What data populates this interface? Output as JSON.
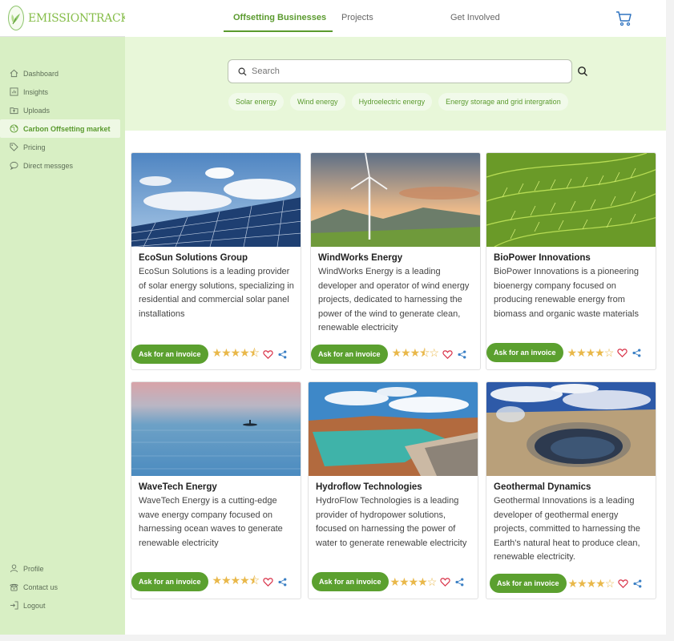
{
  "brand": {
    "name": "EMISSIONTRACK"
  },
  "sidebar": {
    "items": [
      {
        "label": "Dashboard",
        "icon": "home-icon"
      },
      {
        "label": "Insights",
        "icon": "chart-icon"
      },
      {
        "label": "Uploads",
        "icon": "upload-icon"
      },
      {
        "label": "Carbon Offsetting market",
        "icon": "globe-icon",
        "active": true
      },
      {
        "label": "Pricing",
        "icon": "tag-icon"
      },
      {
        "label": "Direct messges",
        "icon": "chat-icon"
      }
    ],
    "bottom": [
      {
        "label": "Profile",
        "icon": "user-icon"
      },
      {
        "label": "Contact us",
        "icon": "phone-icon"
      },
      {
        "label": "Logout",
        "icon": "logout-icon"
      }
    ]
  },
  "topnav": {
    "tabs": [
      {
        "label": "Offsetting Businesses",
        "active": true
      },
      {
        "label": "Projects"
      },
      {
        "label": "Get Involved"
      }
    ]
  },
  "search": {
    "placeholder": "Search"
  },
  "filters": [
    "Solar energy",
    "Wind energy",
    "Hydroelectric energy",
    "Energy storage and grid intergration"
  ],
  "cards": [
    {
      "title": "EcoSun Solutions Group",
      "description": "EcoSun Solutions is a leading provider of solar energy solutions, specializing in residential and commercial solar panel installations",
      "button": "Ask for an invoice",
      "rating": 4.5,
      "image": "solar"
    },
    {
      "title": "WindWorks Energy",
      "description": "WindWorks Energy is a leading developer and operator of wind energy projects, dedicated to harnessing the power of the wind to generate clean, renewable electricity",
      "button": "Ask for an invoice",
      "rating": 3.5,
      "image": "wind"
    },
    {
      "title": "BioPower Innovations",
      "description": "BioPower Innovations is a pioneering bioenergy company focused on producing renewable energy from biomass and organic waste materials",
      "button": "Ask for an invoice",
      "rating": 4,
      "image": "bio"
    },
    {
      "title": "WaveTech Energy",
      "description": "WaveTech Energy is a cutting-edge wave energy company focused on harnessing ocean waves to generate renewable electricity",
      "button": "Ask for an invoice",
      "rating": 4.5,
      "image": "wave"
    },
    {
      "title": "Hydroflow Technologies",
      "description": "HydroFlow Technologies is a leading provider of hydropower solutions, focused on harnessing the power of water to generate renewable electricity",
      "button": "Ask for an invoice",
      "rating": 4,
      "image": "hydro"
    },
    {
      "title": "Geothermal Dynamics",
      "description": "Geothermal Innovations is a leading developer of geothermal energy projects, committed to harnessing the Earth's natural heat to produce clean, renewable electricity.",
      "button": "Ask for an invoice",
      "rating": 4,
      "image": "geo"
    }
  ],
  "colors": {
    "accent": "#5ba02f",
    "sidebar": "#d8efc4",
    "hero": "#e8f7d9",
    "star": "#e9b84a",
    "heart": "#d9344a",
    "share": "#3a7fc4"
  }
}
